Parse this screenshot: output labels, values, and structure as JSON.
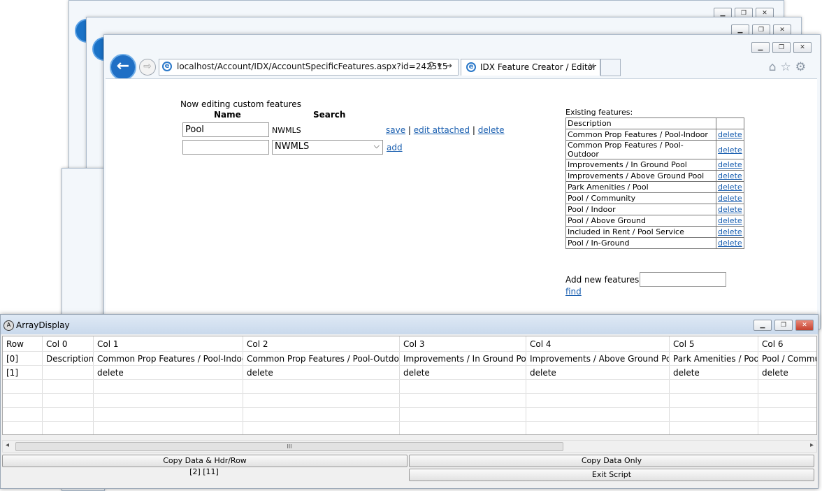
{
  "browser": {
    "url": "localhost/Account/IDX/AccountSpecificFeatures.aspx?id=242515",
    "tab_title": "IDX Feature Creator / Editor",
    "back_glyph": "←",
    "forward_glyph": "⇨"
  },
  "editor": {
    "title": "Now editing custom features",
    "col_name": "Name",
    "col_search": "Search",
    "row1": {
      "name_value": "Pool",
      "search_value": "NWMLS",
      "save": "save",
      "edit_attached": "edit attached",
      "delete": "delete",
      "sep": "|"
    },
    "row2": {
      "name_value": "",
      "search_selected": "NWMLS",
      "add": "add"
    }
  },
  "existing": {
    "title": "Existing features:",
    "header": "Description",
    "delete_label": "delete",
    "items": [
      "Common Prop Features / Pool-Indoor",
      "Common Prop Features / Pool-Outdoor",
      "Improvements / In Ground Pool",
      "Improvements / Above Ground Pool",
      "Park Amenities / Pool",
      "Pool / Community",
      "Pool / Indoor",
      "Pool / Above Ground",
      "Included in Rent / Pool Service",
      "Pool / In-Ground"
    ],
    "add_label": "Add new features:",
    "add_value": "",
    "find": "find"
  },
  "array_display": {
    "title": "ArrayDisplay",
    "columns": [
      "Row",
      "Col 0",
      "Col 1",
      "Col 2",
      "Col 3",
      "Col 4",
      "Col 5",
      "Col 6"
    ],
    "rows": [
      [
        "[0]",
        "Description",
        "Common Prop Features / Pool-Indoor",
        "Common Prop Features / Pool-Outdoor",
        "Improvements / In Ground Pool",
        "Improvements / Above Ground Pool",
        "Park Amenities / Pool",
        "Pool / Community"
      ],
      [
        "[1]",
        "",
        "delete",
        "delete",
        "delete",
        "delete",
        "delete",
        "delete"
      ]
    ],
    "scroll_grip": "III",
    "copy_hdr": "Copy Data & Hdr/Row",
    "copy_only": "Copy Data Only",
    "status": "[2] [11]",
    "exit": "Exit Script"
  }
}
